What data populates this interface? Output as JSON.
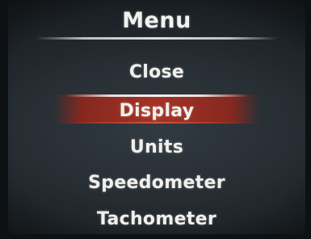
{
  "screen": {
    "title": "Menu",
    "selected_index": 1,
    "accent_color": "#a33225"
  },
  "menu": {
    "items": [
      {
        "label": "Close"
      },
      {
        "label": "Display"
      },
      {
        "label": "Units"
      },
      {
        "label": "Speedometer"
      },
      {
        "label": "Tachometer"
      }
    ]
  }
}
